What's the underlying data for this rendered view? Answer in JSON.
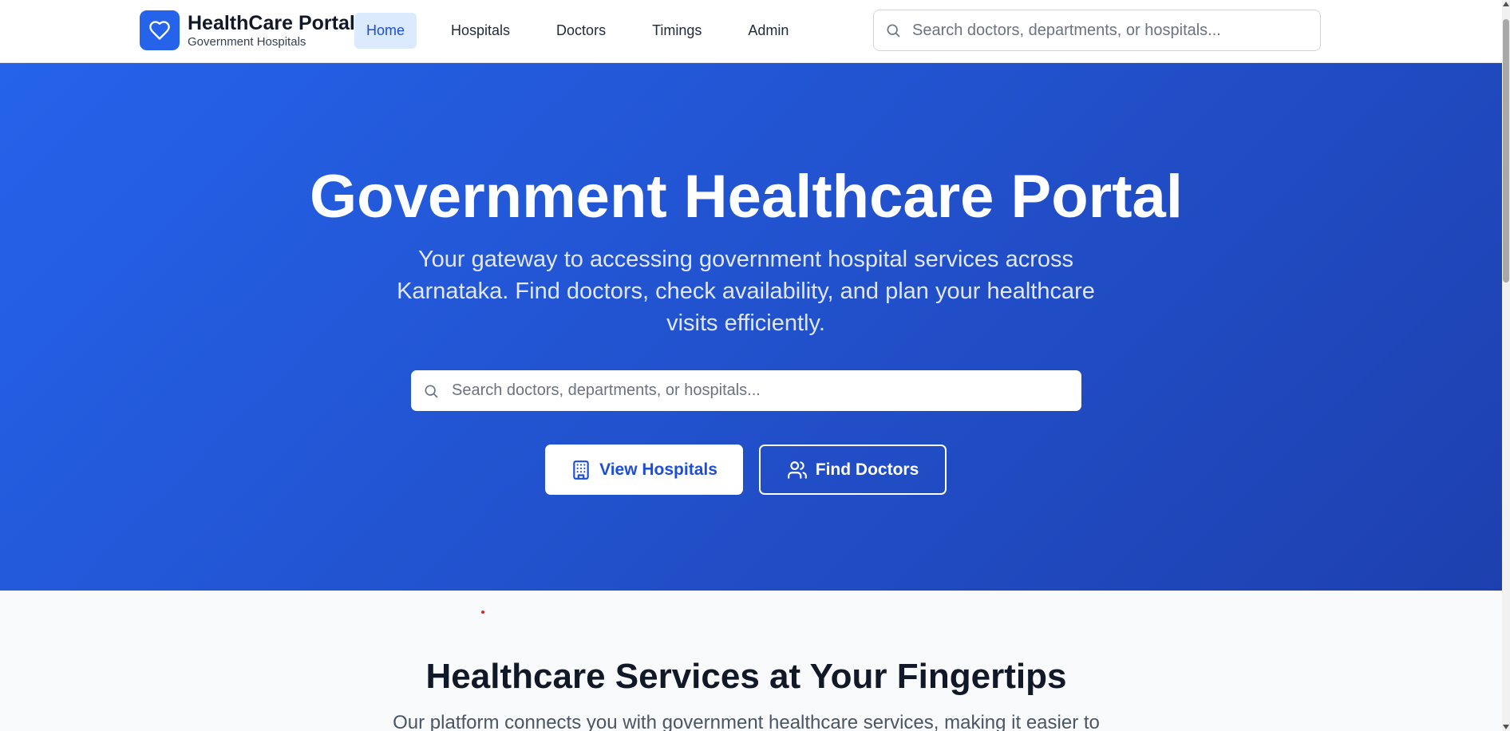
{
  "brand": {
    "title": "HealthCare Portal",
    "subtitle": "Government Hospitals",
    "logo_icon": "heart-icon",
    "color": "#2563eb"
  },
  "nav": {
    "items": [
      {
        "label": "Home",
        "active": true
      },
      {
        "label": "Hospitals",
        "active": false
      },
      {
        "label": "Doctors",
        "active": false
      },
      {
        "label": "Timings",
        "active": false
      },
      {
        "label": "Admin",
        "active": false
      }
    ]
  },
  "header_search": {
    "placeholder": "Search doctors, departments, or hospitals...",
    "icon": "search-icon"
  },
  "hero": {
    "title": "Government Healthcare Portal",
    "description": "Your gateway to accessing government hospital services across Karnataka. Find doctors, check availability, and plan your healthcare visits efficiently.",
    "search_placeholder": "Search doctors, departments, or hospitals...",
    "primary_button": {
      "label": "View Hospitals",
      "icon": "building-icon"
    },
    "secondary_button": {
      "label": "Find Doctors",
      "icon": "users-icon"
    },
    "gradient_start": "#2563eb",
    "gradient_end": "#1e40af"
  },
  "services": {
    "title": "Healthcare Services at Your Fingertips",
    "description": "Our platform connects you with government healthcare services, making it easier to"
  }
}
